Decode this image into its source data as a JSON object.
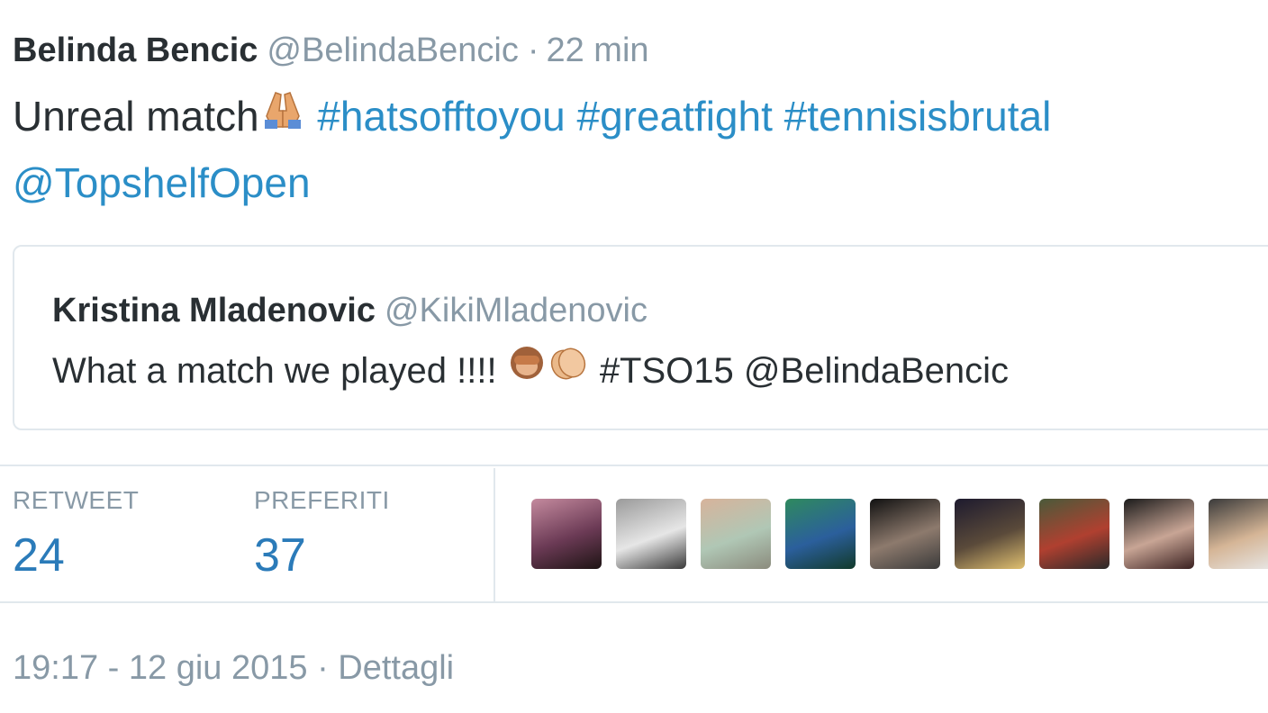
{
  "tweet": {
    "author_name": "Belinda Bencic",
    "author_handle": "@BelindaBencic",
    "separator": "·",
    "time_ago": "22 min",
    "text_prefix": "Unreal match",
    "emoji_hands": "praying-hands-emoji",
    "hashtags": [
      "#hatsofftoyou",
      "#greatfight",
      "#tennisisbrutal"
    ],
    "mention": "@TopshelfOpen"
  },
  "quoted_tweet": {
    "author_name": "Kristina Mladenovic",
    "author_handle": "@KikiMladenovic",
    "text": "What a match we played !!!!",
    "emoji": [
      "see-no-evil-monkey-emoji",
      "clapping-hands-emoji"
    ],
    "hashtag": "#TSO15",
    "mention": "@BelindaBencic"
  },
  "stats": {
    "retweet_label": "RETWEET",
    "retweet_count": "24",
    "favorites_label": "PREFERITI",
    "favorites_count": "37"
  },
  "favoriters": [
    {
      "name": "avatar-1",
      "colors": [
        "#c48a9e",
        "#6b3a55",
        "#1e1414"
      ]
    },
    {
      "name": "avatar-2",
      "colors": [
        "#9a9a9a",
        "#e6e6e6",
        "#3a3a3a"
      ]
    },
    {
      "name": "avatar-3",
      "colors": [
        "#d7b39b",
        "#b0c7b5",
        "#8b8b7d"
      ]
    },
    {
      "name": "avatar-4",
      "colors": [
        "#2f8a5e",
        "#2b5f9c",
        "#123a2a"
      ]
    },
    {
      "name": "avatar-5",
      "colors": [
        "#111111",
        "#8d7a6d",
        "#3a3a3a"
      ]
    },
    {
      "name": "avatar-6",
      "colors": [
        "#1d1a2e",
        "#5a4a3a",
        "#e0c070"
      ]
    },
    {
      "name": "avatar-7",
      "colors": [
        "#4a5a3a",
        "#b04030",
        "#2a2a2a"
      ]
    },
    {
      "name": "avatar-8",
      "colors": [
        "#1b1b1b",
        "#c8a595",
        "#3a2020"
      ]
    },
    {
      "name": "avatar-9",
      "colors": [
        "#3a3a3a",
        "#d5b596",
        "#e8e8e8"
      ]
    }
  ],
  "footer": {
    "timestamp": "19:17 - 12 giu 2015",
    "separator": "·",
    "details_label": "Dettagli"
  },
  "colors": {
    "link": "#2b8ec7",
    "count": "#2b7bb9",
    "muted": "#8899a6",
    "text": "#292f33",
    "border": "#e1e8ed"
  }
}
